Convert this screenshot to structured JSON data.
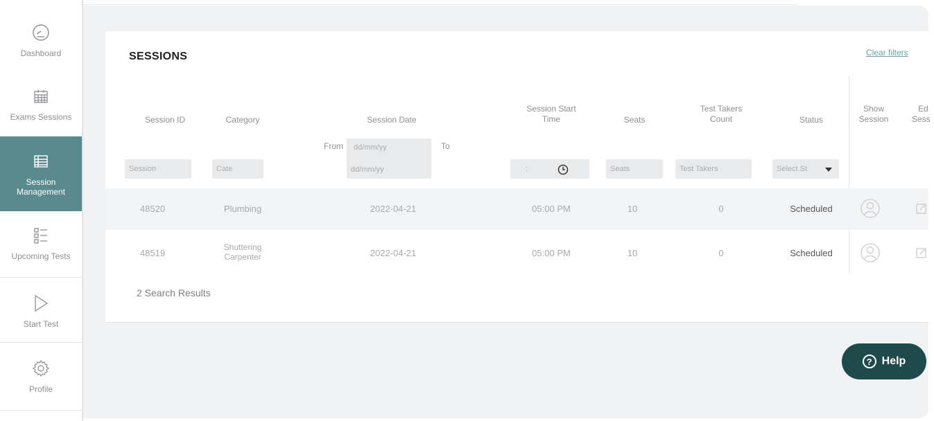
{
  "sidebar": {
    "items": [
      {
        "label": "Dashboard",
        "icon": "gauge-icon"
      },
      {
        "label": "Exams Sessions",
        "icon": "calendar-icon"
      },
      {
        "label": "Session Management",
        "icon": "table-list-icon"
      },
      {
        "label": "Upcoming Tests",
        "icon": "checklist-icon"
      },
      {
        "label": "Start Test",
        "icon": "play-icon"
      },
      {
        "label": "Profile",
        "icon": "gear-icon"
      }
    ],
    "active_color": "#5b8a8e"
  },
  "page": {
    "title": "SESSIONS",
    "clear_filters": "Clear filters"
  },
  "table": {
    "headers": {
      "session_id": "Session ID",
      "category": "Category",
      "session_date": "Session Date",
      "start_time_1": "Session Start",
      "start_time_2": "Time",
      "seats": "Seats",
      "test_takers_1": "Test Takers",
      "test_takers_2": "Count",
      "status": "Status",
      "show_session_1": "Show",
      "show_session_2": "Session",
      "edit_session_1": "Ed",
      "edit_session_2": "Sess"
    },
    "filters": {
      "session_id": "Session",
      "category": "Cate",
      "date_from_label": "From",
      "date_from": "dd/mm/yy",
      "date_to_label": "To",
      "date_to": "dd/mm/yy",
      "time": ":",
      "seats": "Seats",
      "test_takers": "Test Takers",
      "status": "Select St"
    },
    "rows": [
      {
        "session_id": "48520",
        "category_1": "Plumbing",
        "category_2": "",
        "date": "2022-04-21",
        "time": "05:00 PM",
        "seats": "10",
        "test_takers": "0",
        "status": "Scheduled"
      },
      {
        "session_id": "48519",
        "category_1": "Shuttering",
        "category_2": "Carpenter",
        "date": "2022-04-21",
        "time": "05:00 PM",
        "seats": "10",
        "test_takers": "0",
        "status": "Scheduled"
      }
    ],
    "results_text": "2 Search Results"
  },
  "help": {
    "label": "Help"
  }
}
